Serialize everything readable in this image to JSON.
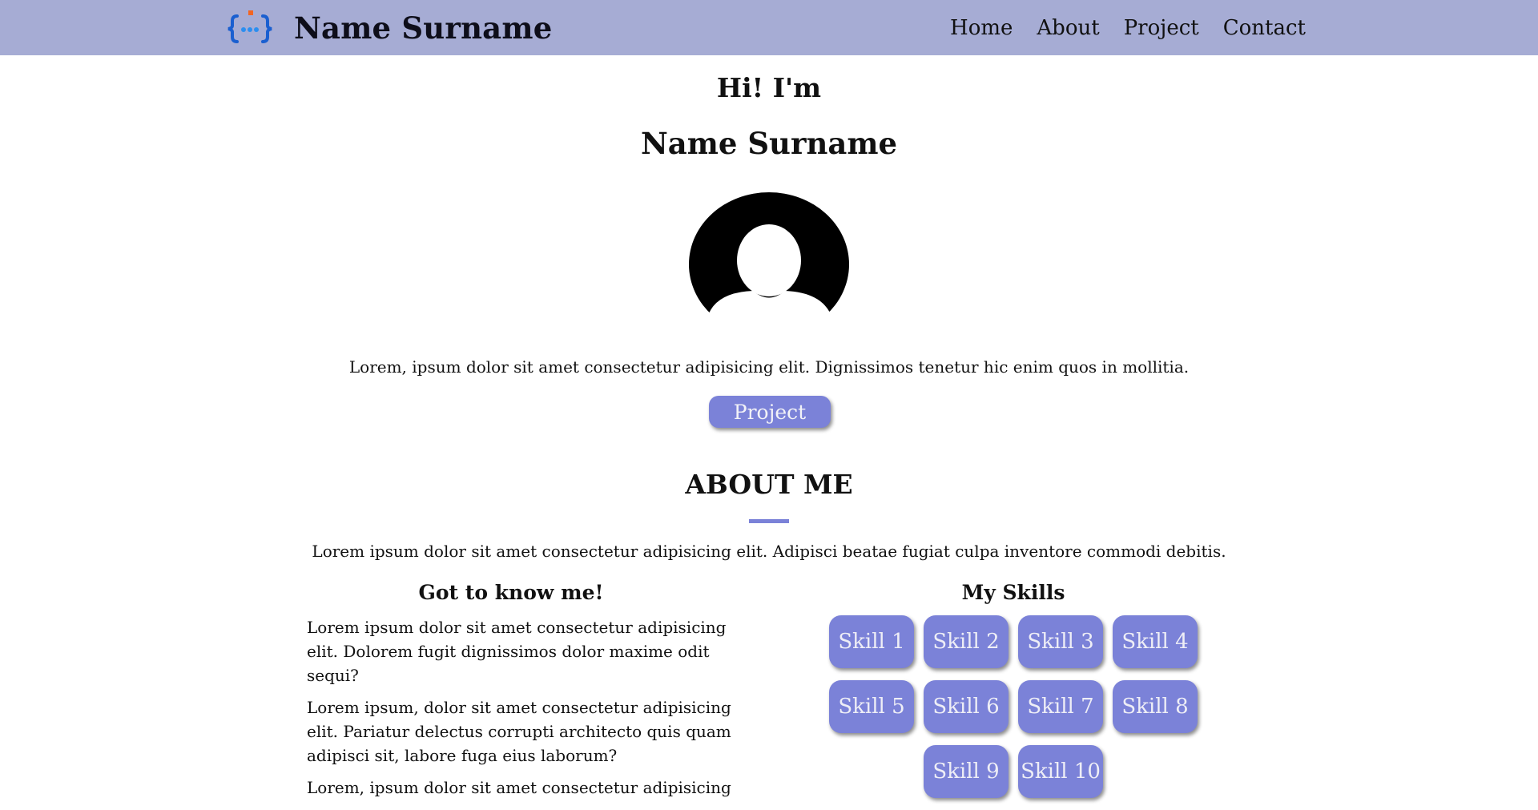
{
  "navbar": {
    "brand_name": "Name Surname",
    "links": [
      "Home",
      "About",
      "Project",
      "Contact"
    ]
  },
  "hero": {
    "greeting": "Hi! I'm",
    "name": "Name Surname",
    "description": "Lorem, ipsum dolor sit amet consectetur adipisicing elit. Dignissimos tenetur hic enim quos in mollitia.",
    "button_label": "Project"
  },
  "about": {
    "title": "ABOUT ME",
    "description": "Lorem ipsum dolor sit amet consectetur adipisicing elit. Adipisci beatae fugiat culpa inventore commodi debitis.",
    "left_heading": "Got to know me!",
    "paragraphs": [
      "Lorem ipsum dolor sit amet consectetur adipisicing elit. Dolorem fugit dignissimos dolor maxime odit sequi?",
      "Lorem ipsum, dolor sit amet consectetur adipisicing elit. Pariatur delectus corrupti architecto quis quam adipisci sit, labore fuga eius laborum?",
      "Lorem, ipsum dolor sit amet consectetur adipisicing"
    ],
    "skills_heading": "My Skills",
    "skills": [
      "Skill 1",
      "Skill 2",
      "Skill 3",
      "Skill 4",
      "Skill 5",
      "Skill 6",
      "Skill 7",
      "Skill 8",
      "Skill 9",
      "Skill 10"
    ]
  },
  "colors": {
    "navbar_bg": "#a6acd4",
    "accent": "#7b82d8",
    "logo_blue": "#1a73e8",
    "logo_orange": "#f26522"
  },
  "icons": {
    "logo": "curly-braces-dots-logo",
    "avatar": "user-avatar-icon"
  }
}
